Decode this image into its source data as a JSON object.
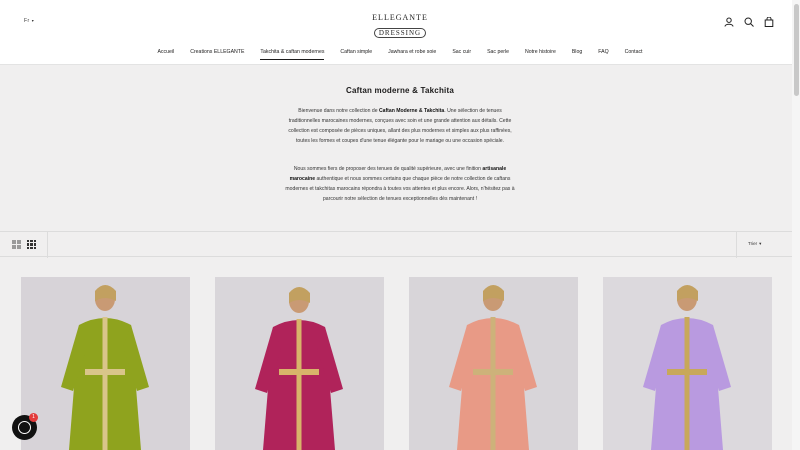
{
  "header": {
    "language": "Fr",
    "logo_line1": "ELLEGANTE",
    "logo_line2": "DRESSING",
    "icons": [
      "account-icon",
      "search-icon",
      "cart-icon"
    ]
  },
  "nav": {
    "items": [
      {
        "label": "Accueil",
        "active": false
      },
      {
        "label": "Creations ELLEGANTE",
        "active": false
      },
      {
        "label": "Takchita & caftan modernes",
        "active": true
      },
      {
        "label": "Caftan simple",
        "active": false
      },
      {
        "label": "Jawhara et robe soie",
        "active": false
      },
      {
        "label": "Sac cuir",
        "active": false
      },
      {
        "label": "Sac perle",
        "active": false
      },
      {
        "label": "Notre histoire",
        "active": false
      },
      {
        "label": "Blog",
        "active": false
      },
      {
        "label": "FAQ",
        "active": false
      },
      {
        "label": "Contact",
        "active": false
      }
    ]
  },
  "collection": {
    "title": "Caftan moderne & Takchita",
    "desc1_a": "Bienvenue dans notre collection de ",
    "desc1_b": "Caftan Moderne & Takchita",
    "desc1_c": ". Une sélection de tenues traditionnelles marocaines modernes, conçues avec soin et une grande attention aux détails. Cette collection est composée de pièces uniques, allant des plus modernes et simples aux plus raffinées, toutes les formes et coupes d'une tenue élégante pour le mariage ou une occasion spéciale.",
    "desc2_a": "Nous sommes fiers de proposer des tenues de qualité supérieure, avec une finition ",
    "desc2_b": "artisanale marocaine",
    "desc2_c": " authentique et nous sommes certains que chaque pièce de notre collection de caftans modernes et takchitas marocains répondra à toutes vos attentes et plus encore. Alors, n'hésitez pas à parcourir notre sélection de tenues exceptionnelles dès maintenant !"
  },
  "toolbar": {
    "sort_label": "Trier",
    "view_options": [
      "grid-2-icon",
      "grid-4-icon"
    ]
  },
  "products": [
    {
      "color": "#8fa31e",
      "trim": "#d9c58a"
    },
    {
      "color": "#b0235a",
      "trim": "#d8b46a"
    },
    {
      "color": "#e89a86",
      "trim": "#cdb27a"
    },
    {
      "color": "#b99ae0",
      "trim": "#c8a85a"
    }
  ],
  "chat": {
    "badge": "1"
  },
  "colors": {
    "background": "#f0efef",
    "header": "#ffffff",
    "text": "#1c1b1b"
  }
}
